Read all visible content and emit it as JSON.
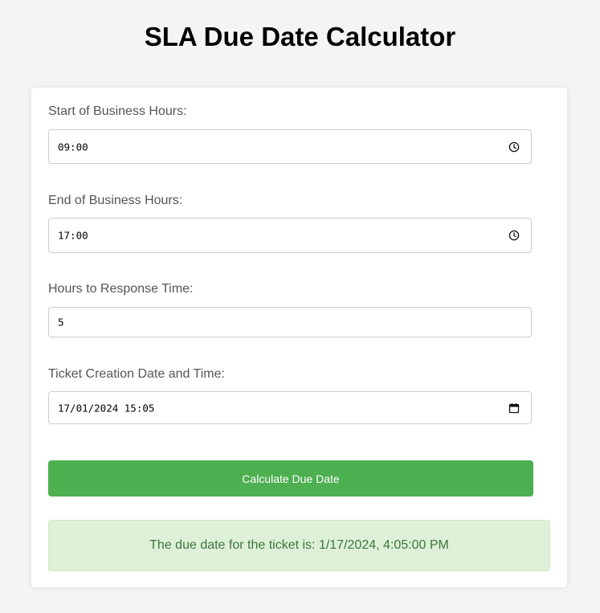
{
  "page": {
    "title": "SLA Due Date Calculator"
  },
  "form": {
    "start_hours": {
      "label": "Start of Business Hours:",
      "value": "09:00",
      "icon": "clock-icon"
    },
    "end_hours": {
      "label": "End of Business Hours:",
      "value": "17:00",
      "icon": "clock-icon"
    },
    "response_hours": {
      "label": "Hours to Response Time:",
      "value": "5"
    },
    "ticket_created": {
      "label": "Ticket Creation Date and Time:",
      "value": "17/01/2024 15:05",
      "icon": "calendar-icon"
    },
    "calculate_button_label": "Calculate Due Date"
  },
  "result": {
    "text": "The due date for the ticket is: 1/17/2024, 4:05:00 PM"
  },
  "colors": {
    "accent": "#4caf50",
    "result_bg": "#dff0d8",
    "result_text": "#3c763d",
    "page_bg": "#f4f4f4"
  }
}
